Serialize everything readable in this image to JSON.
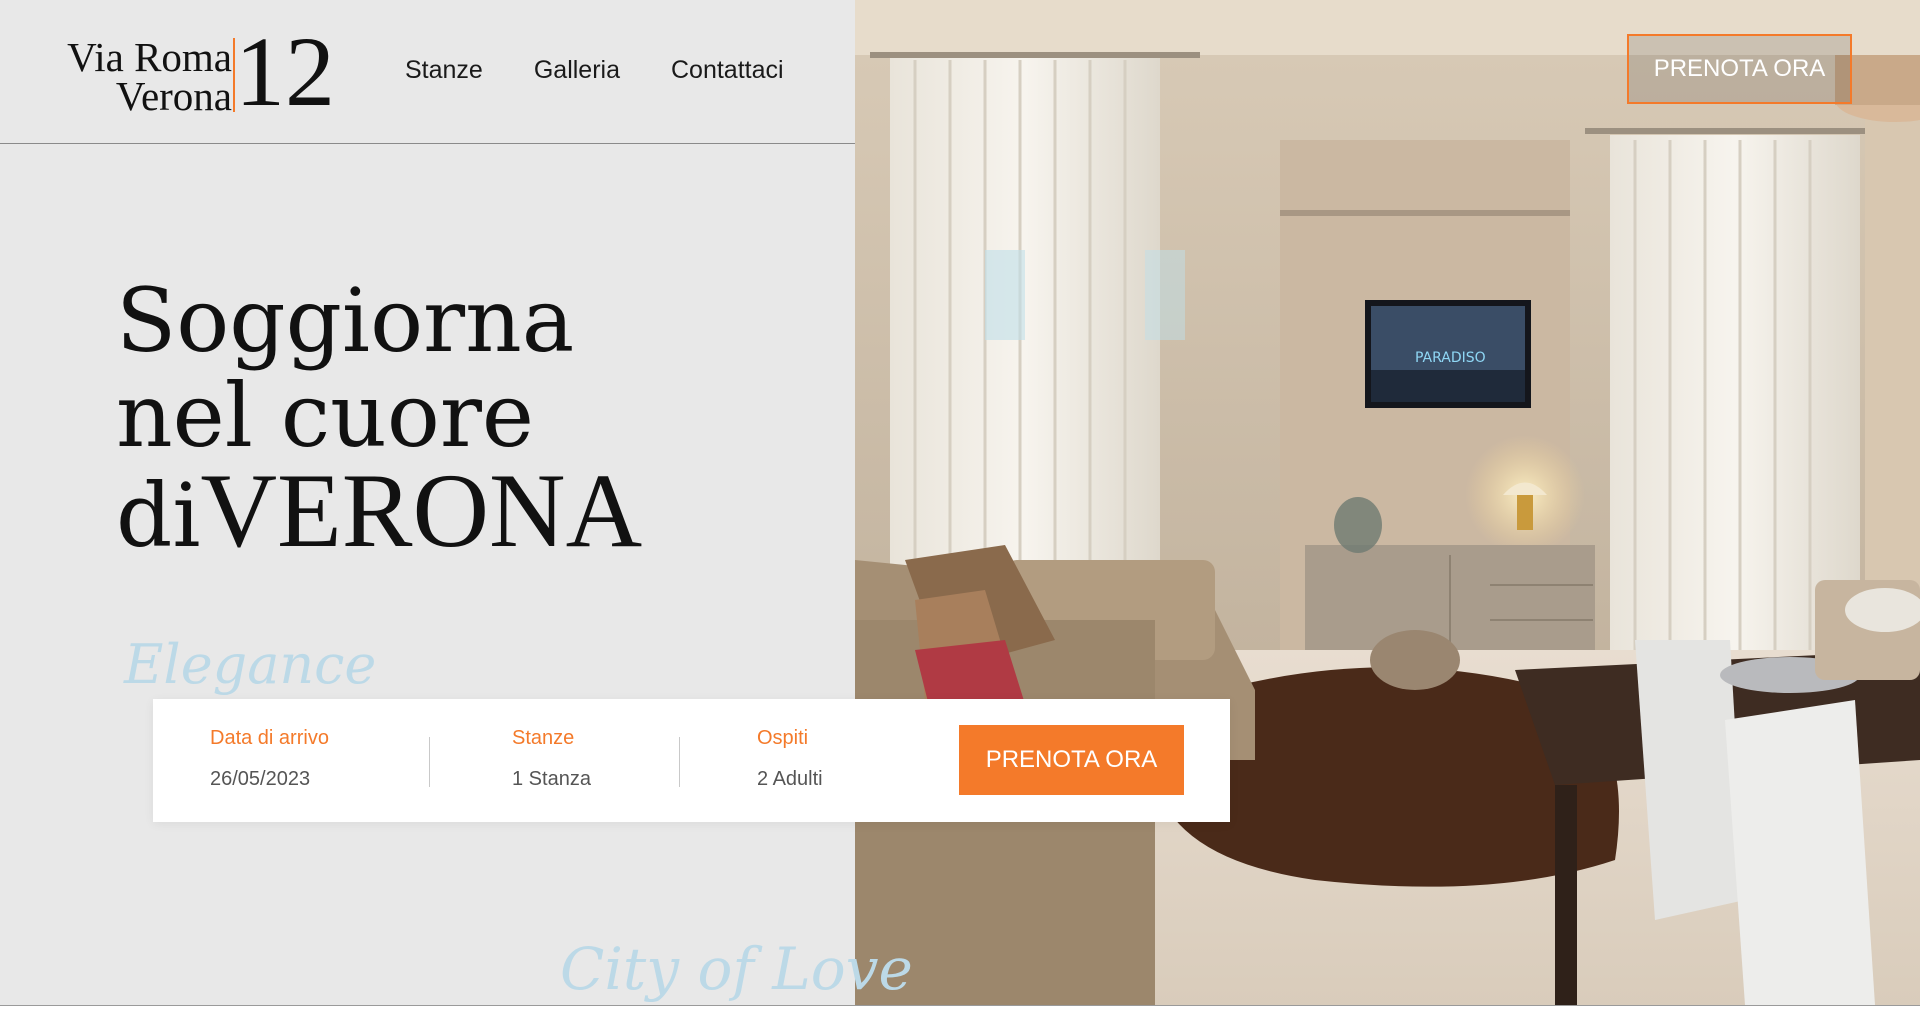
{
  "logo": {
    "line1": "Via Roma",
    "line2": "Verona",
    "number": "12"
  },
  "nav": {
    "items": [
      "Stanze",
      "Galleria",
      "Contattaci"
    ]
  },
  "header": {
    "cta_label": "PRENOTA ORA"
  },
  "hero": {
    "line1": "Soggiorna",
    "line2": "nel cuore",
    "line3_prefix": "di",
    "line3_big": "VERONA"
  },
  "decor": {
    "script1": "Elegance",
    "script2": "City of Love"
  },
  "booking": {
    "arrival_label": "Data di arrivo",
    "arrival_value": "26/05/2023",
    "rooms_label": "Stanze",
    "rooms_value": "1 Stanza",
    "guests_label": "Ospiti",
    "guests_value": "2 Adulti",
    "cta_label": "PRENOTA ORA"
  },
  "photo": {
    "tv_text": "PARADISO"
  },
  "colors": {
    "accent": "#f47a2a",
    "background": "#e8e8e8",
    "script": "#bcd9e7"
  },
  "icons": [
    "logo-mark"
  ]
}
